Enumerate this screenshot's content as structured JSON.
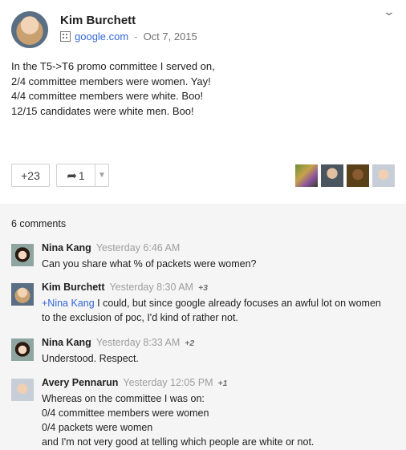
{
  "post": {
    "author": "Kim Burchett",
    "source": "google.com",
    "separator": "-",
    "date": "Oct 7, 2015",
    "lines": [
      "In the T5->T6 promo committee I served on,",
      "2/4 committee members were women. Yay!",
      "4/4 committee members were white. Boo!",
      "12/15 candidates were white men. Boo!"
    ],
    "plus_count": "+23",
    "share_count": "1"
  },
  "comments": {
    "count_label": "6 comments",
    "items": [
      {
        "name": "Nina Kang",
        "time": "Yesterday 6:46 AM",
        "plus": "",
        "mention": "",
        "lines": [
          "Can you share what % of packets were women?"
        ]
      },
      {
        "name": "Kim Burchett",
        "time": "Yesterday 8:30 AM",
        "plus": "+3",
        "mention": "+Nina Kang",
        "lines": [
          " I could, but since google already focuses an awful lot on women",
          "to the exclusion of poc, I'd kind of rather not."
        ]
      },
      {
        "name": "Nina Kang",
        "time": "Yesterday 8:33 AM",
        "plus": "+2",
        "mention": "",
        "lines": [
          "Understood. Respect."
        ]
      },
      {
        "name": "Avery Pennarun",
        "time": "Yesterday 12:05 PM",
        "plus": "+1",
        "mention": "",
        "lines": [
          "Whereas on the committee I was on:",
          "0/4 committee members were women",
          "0/4 packets were women",
          "and I'm not very good at telling which people are white or not."
        ]
      }
    ]
  },
  "icons": {
    "menu": "chevron-down-icon",
    "source": "building-icon",
    "share": "share-arrow-icon",
    "share_menu": "dropdown-triangle-icon"
  }
}
